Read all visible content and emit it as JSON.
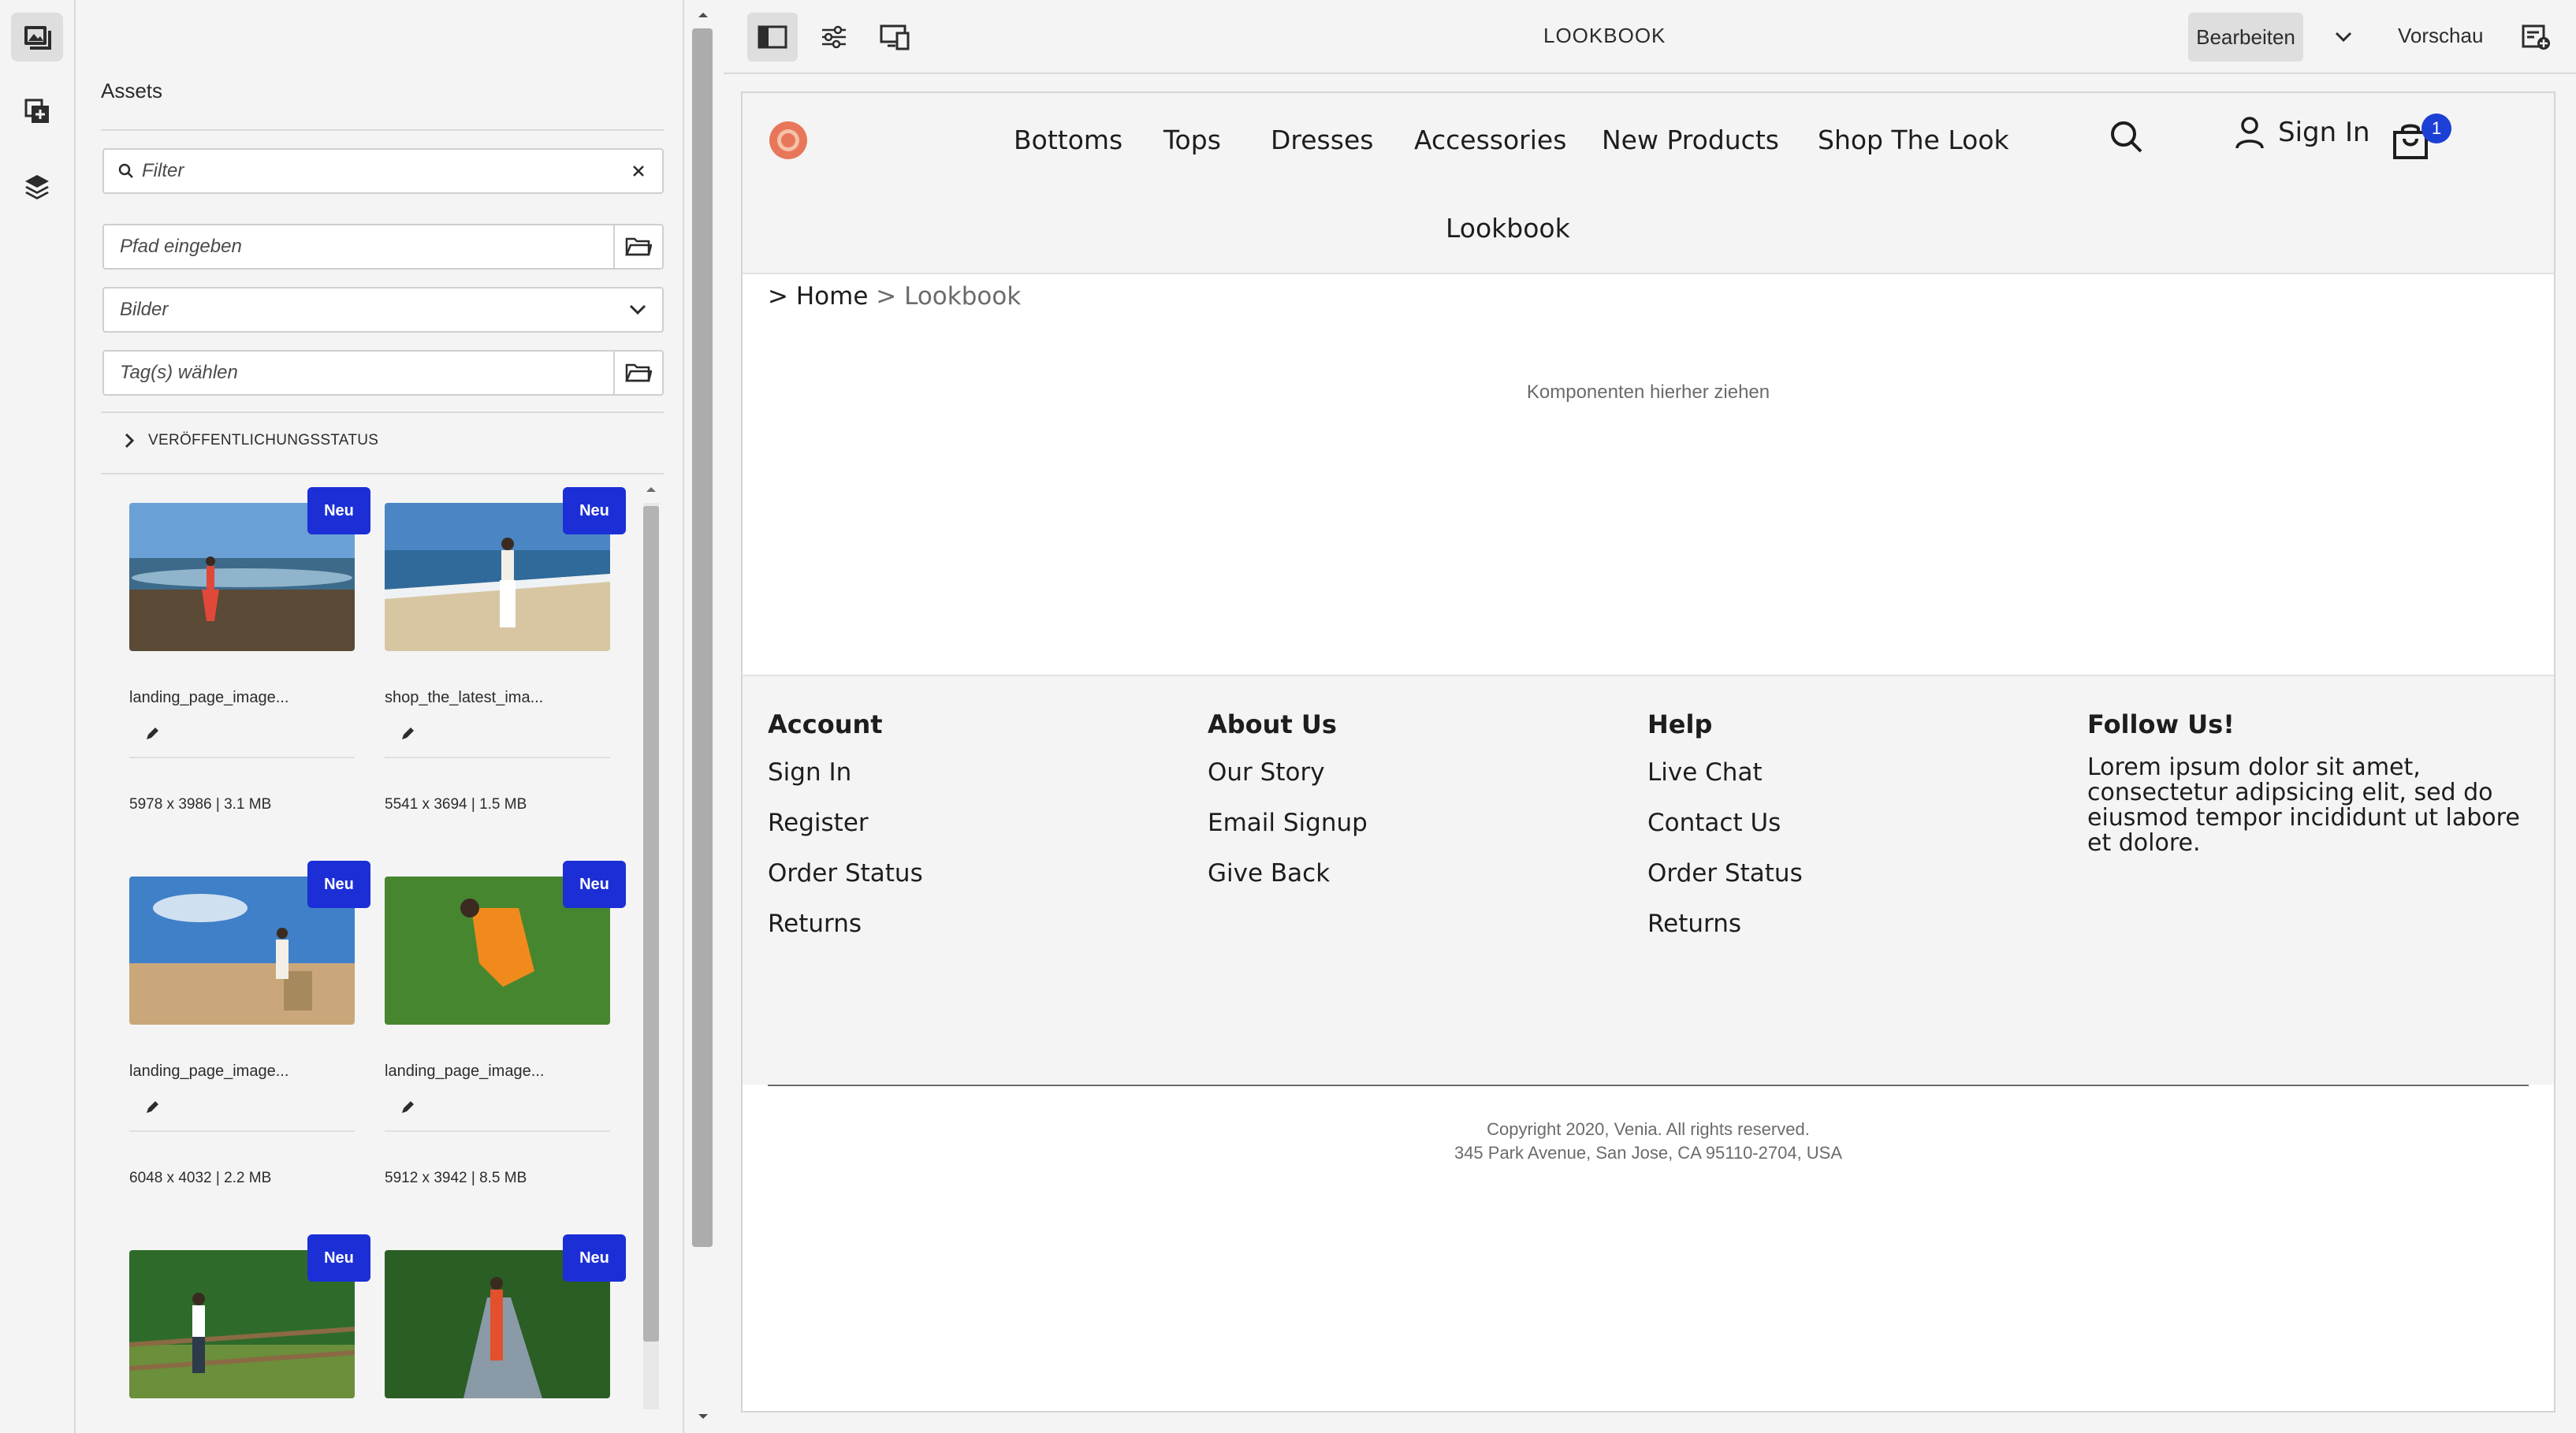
{
  "toolbar": {
    "page_title": "LOOKBOOK",
    "edit_label": "Bearbeiten",
    "preview_label": "Vorschau"
  },
  "assets_panel": {
    "title": "Assets",
    "filter_placeholder": "Filter",
    "path_placeholder": "Pfad eingeben",
    "type_selected": "Bilder",
    "tags_placeholder": "Tag(s) wählen",
    "publication_status_label": "VERÖFFENTLICHUNGSSTATUS",
    "new_badge": "Neu",
    "items": [
      {
        "name": "landing_page_image...",
        "meta": "5978 x 3986 | 3.1 MB"
      },
      {
        "name": "shop_the_latest_ima...",
        "meta": "5541 x 3694 | 1.5 MB"
      },
      {
        "name": "landing_page_image...",
        "meta": "6048 x 4032 | 2.2 MB"
      },
      {
        "name": "landing_page_image...",
        "meta": "5912 x 3942 | 8.5 MB"
      },
      {
        "name": "",
        "meta": ""
      },
      {
        "name": "",
        "meta": ""
      }
    ]
  },
  "site": {
    "nav": [
      "Bottoms",
      "Tops",
      "Dresses",
      "Accessories",
      "New Products",
      "Shop The Look"
    ],
    "nav_second_row": "Lookbook",
    "sign_in": "Sign In",
    "cart_count": "1",
    "breadcrumb": {
      "prefix": ">",
      "home": "Home",
      "sep": ">",
      "current": "Lookbook"
    },
    "dropzone": "Komponenten hierher ziehen",
    "footer": {
      "account": {
        "head": "Account",
        "links": [
          "Sign In",
          "Register",
          "Order Status",
          "Returns"
        ]
      },
      "about": {
        "head": "About Us",
        "links": [
          "Our Story",
          "Email Signup",
          "Give Back"
        ]
      },
      "help": {
        "head": "Help",
        "links": [
          "Live Chat",
          "Contact Us",
          "Order Status",
          "Returns"
        ]
      },
      "follow": {
        "head": "Follow Us!",
        "text": "Lorem ipsum dolor sit amet, consectetur adipsicing elit, sed do eiusmod tempor incididunt ut labore et dolore."
      },
      "copyright_line1": "Copyright 2020, Venia. All rights reserved.",
      "copyright_line2": "345 Park Avenue, San Jose, CA 95110-2704, USA"
    }
  },
  "colors": {
    "badge": "#1c2fd6",
    "cart_badge": "#1c3fd6",
    "logo": "#e8765a"
  }
}
